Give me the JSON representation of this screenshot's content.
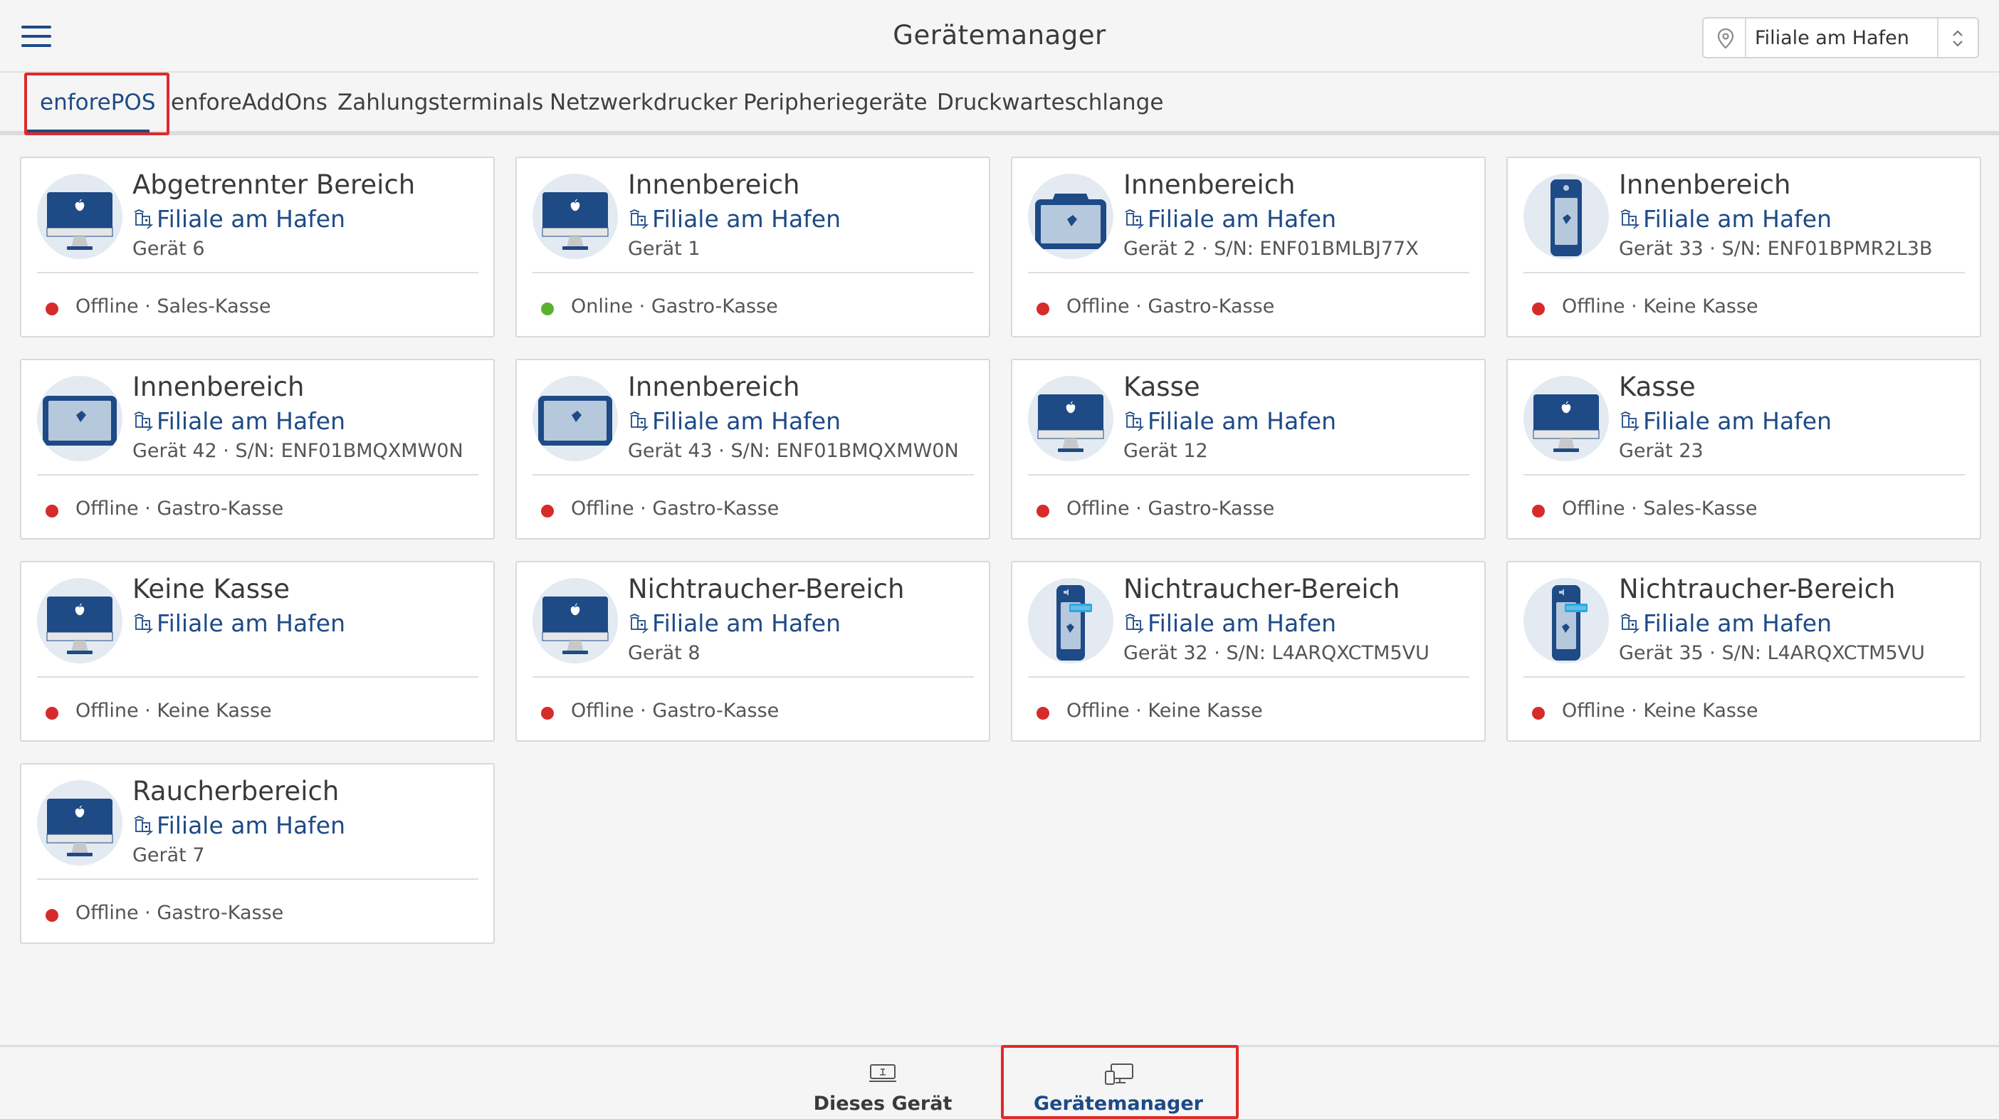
{
  "header": {
    "title": "Gerätemanager",
    "menu_icon": "hamburger-menu-icon",
    "branch_selector": {
      "icon": "location-pin-icon",
      "value": "Filiale am Hafen",
      "toggle_icon": "chevron-updown-icon"
    }
  },
  "tabs": [
    {
      "label": "enforePOS",
      "active": true
    },
    {
      "label": "enforeAddOns",
      "active": false
    },
    {
      "label": "Zahlungsterminals",
      "active": false
    },
    {
      "label": "Netzwerkdrucker",
      "active": false
    },
    {
      "label": "Peripheriegeräte",
      "active": false
    },
    {
      "label": "Druckwarteschlange",
      "active": false
    }
  ],
  "devices": [
    {
      "name": "Abgetrennter Bereich",
      "branch": "Filiale am Hafen",
      "device": "Gerät 6",
      "status": "Offline · Sales-Kasse",
      "state": "offline",
      "icon": "imac"
    },
    {
      "name": "Innenbereich",
      "branch": "Filiale am Hafen",
      "device": "Gerät 1",
      "status": "Online · Gastro-Kasse",
      "state": "online",
      "icon": "imac"
    },
    {
      "name": "Innenbereich",
      "branch": "Filiale am Hafen",
      "device": "Gerät 2 · S/N: ENF01BMLBJ77X",
      "status": "Offline · Gastro-Kasse",
      "state": "offline",
      "icon": "pos-terminal"
    },
    {
      "name": "Innenbereich",
      "branch": "Filiale am Hafen",
      "device": "Gerät 33 · S/N: ENF01BPMR2L3B",
      "status": "Offline · Keine Kasse",
      "state": "offline",
      "icon": "handheld"
    },
    {
      "name": "Innenbereich",
      "branch": "Filiale am Hafen",
      "device": "Gerät 42 · S/N: ENF01BMQXMW0N",
      "status": "Offline · Gastro-Kasse",
      "state": "offline",
      "icon": "tablet"
    },
    {
      "name": "Innenbereich",
      "branch": "Filiale am Hafen",
      "device": "Gerät 43 · S/N: ENF01BMQXMW0N",
      "status": "Offline · Gastro-Kasse",
      "state": "offline",
      "icon": "tablet"
    },
    {
      "name": "Kasse",
      "branch": "Filiale am Hafen",
      "device": "Gerät 12",
      "status": "Offline · Gastro-Kasse",
      "state": "offline",
      "icon": "imac"
    },
    {
      "name": "Kasse",
      "branch": "Filiale am Hafen",
      "device": "Gerät 23",
      "status": "Offline · Sales-Kasse",
      "state": "offline",
      "icon": "imac"
    },
    {
      "name": "Keine Kasse",
      "branch": "Filiale am Hafen",
      "device": "",
      "status": "Offline · Keine Kasse",
      "state": "offline",
      "icon": "imac"
    },
    {
      "name": "Nichtraucher-Bereich",
      "branch": "Filiale am Hafen",
      "device": "Gerät 8",
      "status": "Offline · Gastro-Kasse",
      "state": "offline",
      "icon": "imac"
    },
    {
      "name": "Nichtraucher-Bereich",
      "branch": "Filiale am Hafen",
      "device": "Gerät 32 · S/N: L4ARQXCTM5VU",
      "status": "Offline · Keine Kasse",
      "state": "offline",
      "icon": "paypad"
    },
    {
      "name": "Nichtraucher-Bereich",
      "branch": "Filiale am Hafen",
      "device": "Gerät 35 · S/N: L4ARQXCTM5VU",
      "status": "Offline · Keine Kasse",
      "state": "offline",
      "icon": "paypad"
    },
    {
      "name": "Raucherbereich",
      "branch": "Filiale am Hafen",
      "device": "Gerät 7",
      "status": "Offline · Gastro-Kasse",
      "state": "offline",
      "icon": "imac"
    }
  ],
  "bottom_nav": [
    {
      "label": "Dieses Gerät",
      "icon": "this-device-icon",
      "active": false
    },
    {
      "label": "Gerätemanager",
      "icon": "device-manager-icon",
      "active": true
    }
  ],
  "colors": {
    "brand": "#1e4a86",
    "offline": "#d62b2b",
    "online": "#5ab130",
    "highlight": "#e02a2a"
  }
}
